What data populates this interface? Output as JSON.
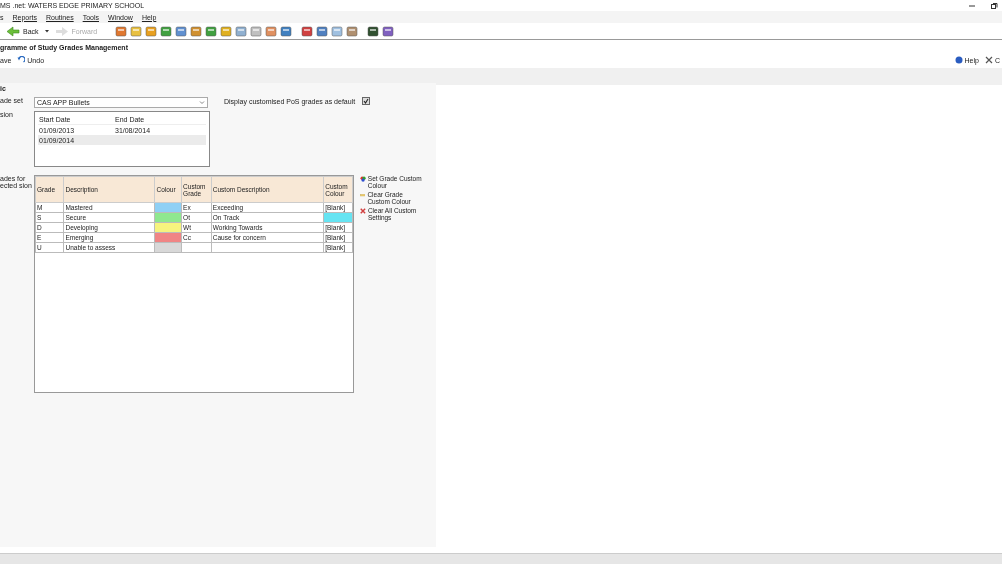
{
  "window": {
    "title": "MS .net: WATERS EDGE PRIMARY SCHOOL"
  },
  "menu": [
    "s",
    "Reports",
    "Routines",
    "Tools",
    "Window",
    "Help"
  ],
  "toolbar": {
    "back": "Back",
    "forward": "Forward",
    "forward_disabled": true
  },
  "page": {
    "title": "gramme of Study Grades Management",
    "actions": [
      "ave",
      "Undo"
    ],
    "right_actions": [
      "Help",
      "C"
    ]
  },
  "form": {
    "section": "ic",
    "grade_set": {
      "label": "ade set",
      "value": "CAS APP Bullets"
    },
    "default_checkbox": {
      "label": "Display customised PoS grades as default",
      "checked": true
    },
    "version": {
      "label": "sion",
      "columns": [
        "Start Date",
        "End Date"
      ],
      "rows": [
        {
          "start": "01/09/2013",
          "end": "31/08/2014",
          "selected": false
        },
        {
          "start": "01/09/2014",
          "selected": true
        }
      ]
    },
    "grades_label": "ades for ected sion",
    "grades": {
      "columns": [
        "Grade",
        "Description",
        "Colour",
        "Custom Grade",
        "Custom Description",
        "Custom Colour"
      ],
      "rows": [
        {
          "grade": "M",
          "description": "Mastered",
          "color": "#8fd0f5",
          "custom_grade": "Ex",
          "custom_description": "Exceeding",
          "custom_colour": {
            "kind": "text",
            "text": "[Blank]"
          }
        },
        {
          "grade": "S",
          "description": "Secure",
          "color": "#8fe88f",
          "custom_grade": "Ot",
          "custom_description": "On Track",
          "custom_colour": {
            "kind": "swatch",
            "color": "#66e4f2"
          }
        },
        {
          "grade": "D",
          "description": "Developing",
          "color": "#f6f47e",
          "custom_grade": "Wt",
          "custom_description": "Working Towards",
          "custom_colour": {
            "kind": "text",
            "text": "[Blank]"
          }
        },
        {
          "grade": "E",
          "description": "Emerging",
          "color": "#f08585",
          "custom_grade": "Cc",
          "custom_description": "Cause for concern",
          "custom_colour": {
            "kind": "text",
            "text": "[Blank]"
          }
        },
        {
          "grade": "U",
          "description": "Unable to assess",
          "color": "#d8d8d8",
          "custom_colour": {
            "kind": "text",
            "text": "[Blank]"
          }
        }
      ]
    },
    "side_actions": [
      {
        "kind": "set",
        "label": "Set Grade Custom Colour"
      },
      {
        "kind": "clear",
        "label": "Clear Grade Custom Colour"
      },
      {
        "kind": "clear_all",
        "label": "Clear All Custom Settings"
      }
    ]
  }
}
